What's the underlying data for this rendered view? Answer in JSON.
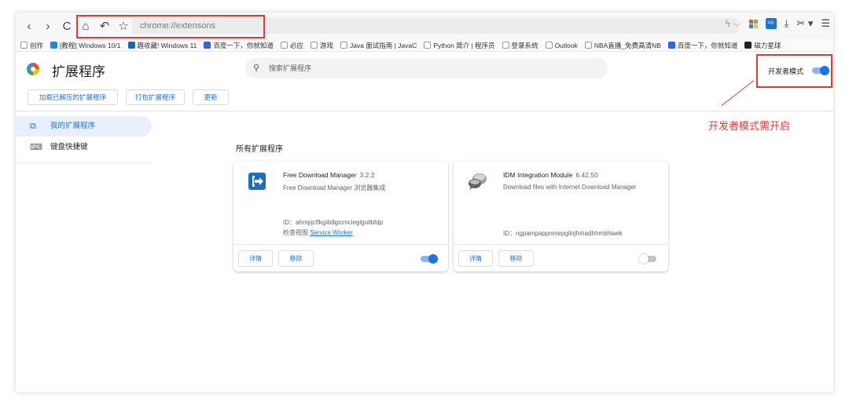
{
  "toolbar": {
    "back_icon": "‹",
    "forward_icon": "›",
    "reload_icon": "C",
    "home_icon": "⌂",
    "undo_icon": "↶",
    "star_icon": "☆",
    "address": "chrome://extensons",
    "lightning_icon": "ϟ ⌵",
    "download_icon": "⤓",
    "scissors_icon": "✂ ▾",
    "menu_icon": "☰"
  },
  "bookmarks": [
    {
      "label": "创作",
      "color": "#ffffff"
    },
    {
      "label": "[教程] Windows 10/1",
      "color": "#1e88e5"
    },
    {
      "label": "趣收藏! Windows 11",
      "color": "#1565c0"
    },
    {
      "label": "百度一下，你就知道",
      "color": "#2962ff"
    },
    {
      "label": "必应",
      "color": "#ffffff"
    },
    {
      "label": "游戏",
      "color": "#ffffff"
    },
    {
      "label": "Java 面试指南 | JavaC",
      "color": "#ffffff"
    },
    {
      "label": "Python 简介 | 程序员",
      "color": "#ffffff"
    },
    {
      "label": "登录系统",
      "color": "#ffffff"
    },
    {
      "label": "Outlook",
      "color": "#ffffff"
    },
    {
      "label": "NBA直播_免费高清NB",
      "color": "#ffffff"
    },
    {
      "label": "百度一下，你就知道",
      "color": "#2962ff"
    },
    {
      "label": "磁力星球",
      "color": "#222222"
    }
  ],
  "header": {
    "title": "扩展程序",
    "search_placeholder": "搜索扩展程序",
    "dev_mode_label": "开发者模式",
    "dev_mode_on": true
  },
  "actions": {
    "load_unpacked": "加载已解压的扩展程序",
    "pack": "打包扩展程序",
    "update": "更新"
  },
  "sidebar": {
    "items": [
      {
        "label": "我的扩展程序",
        "icon": "puzzle-icon",
        "active": true
      },
      {
        "label": "键盘快捷键",
        "icon": "keyboard-icon",
        "active": false
      }
    ]
  },
  "main": {
    "section_title": "所有扩展程序",
    "cards": [
      {
        "name": "Free Download Manager",
        "version": "3.2.2",
        "description": "Free Download Manager 浏览器集成",
        "id": "ID：ahmpjcflkgiildlgicmcieglgoilbfdp",
        "inspect_label": "检查视图",
        "inspect_link": "Service Worker",
        "details": "详情",
        "remove": "移除",
        "enabled": true
      },
      {
        "name": "IDM Integration Module",
        "version": "6.42.50",
        "description": "Download files with Internet Download Manager",
        "id": "ID：ngpampappnmepgilojfohadhhmbhlaek",
        "details": "详情",
        "remove": "移除",
        "enabled": false
      }
    ]
  },
  "annotation": {
    "text": "开发者模式需开启",
    "color": "#e53935"
  }
}
